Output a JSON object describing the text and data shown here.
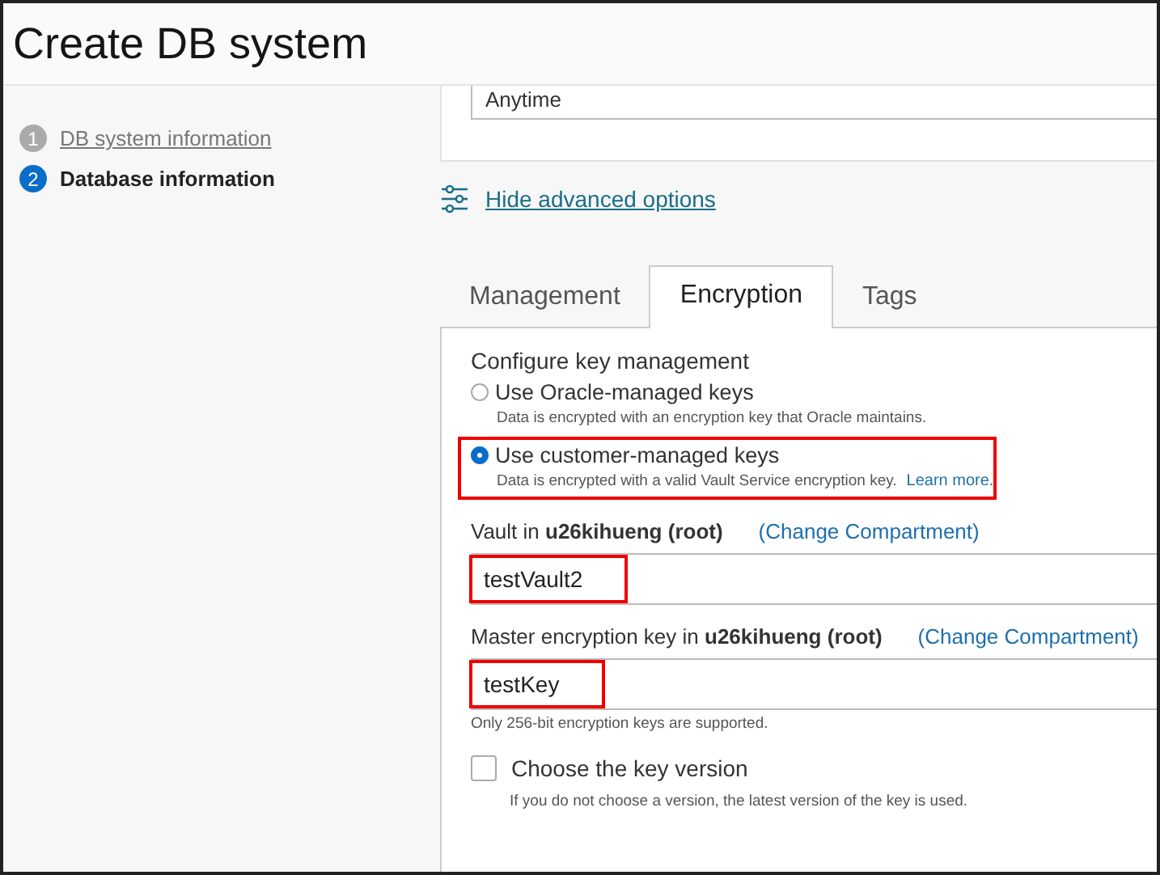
{
  "page_title": "Create DB system",
  "steps": [
    {
      "number": "1",
      "label": "DB system information",
      "selected": false
    },
    {
      "number": "2",
      "label": "Database information",
      "selected": true
    }
  ],
  "previous_field": {
    "value": "Anytime"
  },
  "advanced_link": "Hide advanced options",
  "tabs": [
    {
      "label": "Management",
      "selected": false
    },
    {
      "label": "Encryption",
      "selected": true
    },
    {
      "label": "Tags",
      "selected": false
    }
  ],
  "key_management": {
    "label": "Configure key management",
    "options": [
      {
        "label": "Use Oracle-managed keys",
        "help": "Data is encrypted with an encryption key that Oracle maintains.",
        "selected": false,
        "highlighted": false
      },
      {
        "label": "Use customer-managed keys",
        "help": "Data is encrypted with a valid Vault Service encryption key.",
        "link": "Learn more.",
        "selected": true,
        "highlighted": true
      }
    ]
  },
  "fields": [
    {
      "label": "Vault in **u26kihueng (root)**",
      "link": "(Change Compartment)",
      "value": "testVault2",
      "highlighted": true
    },
    {
      "label": "Master encryption key in **u26kihueng (root)**",
      "link": "(Change Compartment)",
      "value": "testKey",
      "highlighted": true,
      "help": "Only 256-bit encryption keys are supported."
    }
  ],
  "key_version": {
    "label": "Choose the key version",
    "checked": false,
    "help": "If you do not choose a version, the latest version of the key is used."
  }
}
